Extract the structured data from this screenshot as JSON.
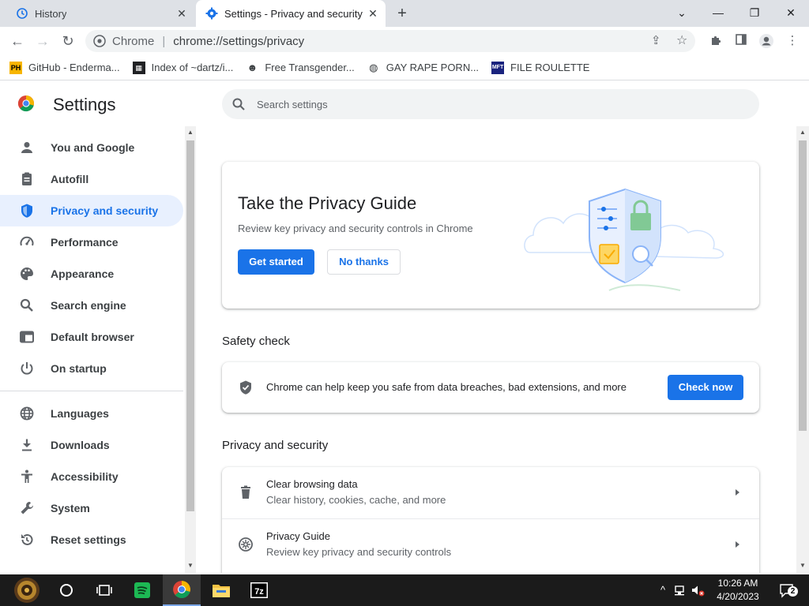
{
  "tabs": [
    {
      "title": "History",
      "icon": "history-icon"
    },
    {
      "title": "Settings - Privacy and security",
      "icon": "gear-icon"
    }
  ],
  "toolbar": {
    "site_chip": "Chrome",
    "url": "chrome://settings/privacy"
  },
  "bookmarks": [
    {
      "label": "GitHub - Enderma...",
      "favicon": "PH"
    },
    {
      "label": "Index of ~dartz/i...",
      "favicon": "grid"
    },
    {
      "label": "Free Transgender...",
      "favicon": "mask"
    },
    {
      "label": "GAY RAPE PORN...",
      "favicon": "globe"
    },
    {
      "label": "FILE ROULETTE",
      "favicon": "MFT"
    }
  ],
  "header": {
    "title": "Settings",
    "search_placeholder": "Search settings"
  },
  "sidebar": {
    "items": [
      {
        "label": "You and Google",
        "icon": "person-icon"
      },
      {
        "label": "Autofill",
        "icon": "clipboard-icon"
      },
      {
        "label": "Privacy and security",
        "icon": "shield-icon",
        "active": true
      },
      {
        "label": "Performance",
        "icon": "speedometer-icon"
      },
      {
        "label": "Appearance",
        "icon": "palette-icon"
      },
      {
        "label": "Search engine",
        "icon": "search-icon"
      },
      {
        "label": "Default browser",
        "icon": "browser-window-icon"
      },
      {
        "label": "On startup",
        "icon": "power-icon"
      },
      {
        "label": "Languages",
        "icon": "globe-icon"
      },
      {
        "label": "Downloads",
        "icon": "download-icon"
      },
      {
        "label": "Accessibility",
        "icon": "accessibility-icon"
      },
      {
        "label": "System",
        "icon": "wrench-icon"
      },
      {
        "label": "Reset settings",
        "icon": "reset-icon"
      }
    ]
  },
  "privacy_guide": {
    "title": "Take the Privacy Guide",
    "description": "Review key privacy and security controls in Chrome",
    "primary_button": "Get started",
    "secondary_button": "No thanks"
  },
  "safety_check": {
    "section_title": "Safety check",
    "text": "Chrome can help keep you safe from data breaches, bad extensions, and more",
    "button": "Check now"
  },
  "privacy_section": {
    "section_title": "Privacy and security",
    "rows": [
      {
        "title": "Clear browsing data",
        "subtitle": "Clear history, cookies, cache, and more",
        "icon": "trash-icon"
      },
      {
        "title": "Privacy Guide",
        "subtitle": "Review key privacy and security controls",
        "icon": "privacy-guide-icon"
      }
    ]
  },
  "taskbar": {
    "time": "10:26 AM",
    "date": "4/20/2023",
    "notification_count": "2",
    "apps": [
      "start",
      "cortana",
      "task-view",
      "spotify",
      "chrome",
      "file-explorer",
      "7-zip"
    ]
  },
  "colors": {
    "accent": "#1a73e8",
    "active_nav_bg": "#e8f0fe",
    "tabstrip_bg": "#dee1e6",
    "taskbar_bg": "#1b1b1b"
  }
}
